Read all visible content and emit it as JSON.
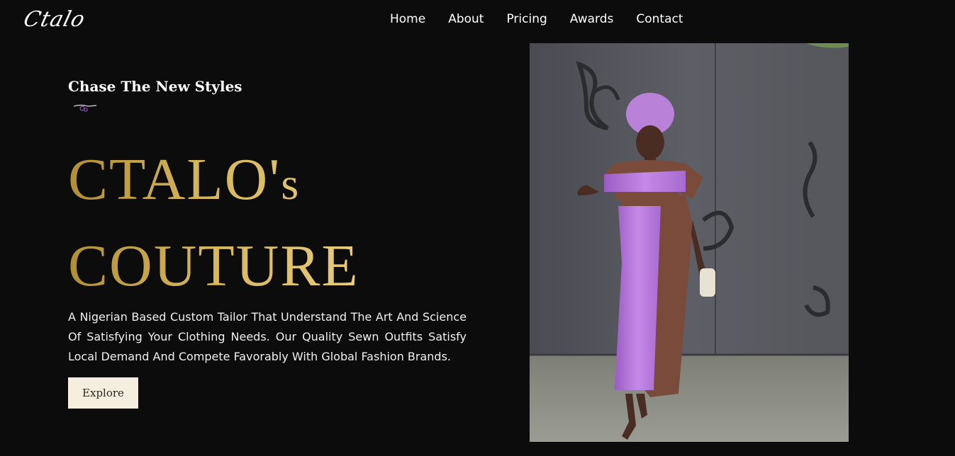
{
  "brand": {
    "logo_text": "Ctalo"
  },
  "nav": {
    "items": [
      "Home",
      "About",
      "Pricing",
      "Awards",
      "Contact"
    ]
  },
  "hero": {
    "tagline": "Chase The New Styles",
    "title_line1_main": "CTALO'",
    "title_line1_small": "s",
    "title_line2": "COUTURE",
    "description": "A Nigerian Based Custom Tailor That Understand The Art And Science Of Satisfying Your Clothing Needs. Our Quality Sewn Outfits Satisfy Local Demand And Compete Favorably With Global Fashion Brands.",
    "cta_label": "Explore"
  },
  "colors": {
    "background": "#0c0c0c",
    "gold": "#d5b55a",
    "button_bg": "#f6efdf",
    "outfit_purple": "#b77ad8"
  },
  "icons": {
    "tagline_ornament": "needle-thread-icon"
  }
}
